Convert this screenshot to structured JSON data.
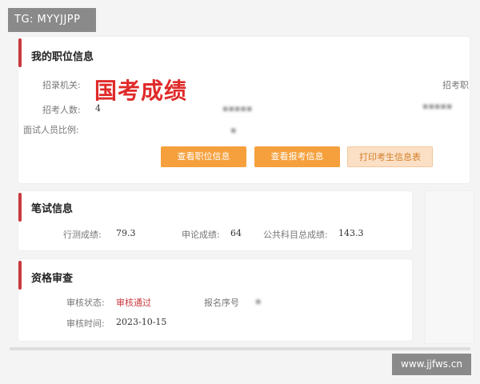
{
  "watermark_top": "TG: MYYJJPP",
  "watermark_bottom": "www.jjfws.cn",
  "stamp_text": "国考成绩",
  "position_info": {
    "title": "我的职位信息",
    "recruit_org_label": "招录机关:",
    "recruit_count_label": "招考人数:",
    "recruit_count_value": "4",
    "interview_ratio_label": "面试人员比例:",
    "right_label_1": "招考职"
  },
  "buttons": {
    "view_position": "查看职位信息",
    "view_application": "查看报考信息",
    "print_info": "打印考生信息表"
  },
  "written_exam": {
    "title": "笔试信息",
    "items": [
      {
        "label": "行测成绩:",
        "value": "79.3"
      },
      {
        "label": "申论成绩:",
        "value": "64"
      },
      {
        "label": "公共科目总成绩:",
        "value": "143.3"
      }
    ]
  },
  "qualification": {
    "title": "资格审查",
    "status_label": "审核状态:",
    "status_value": "审核通过",
    "serial_label": "报名序号",
    "time_label": "审核时间:",
    "time_value": "2023-10-15"
  },
  "colors": {
    "accent_red": "#c9393f",
    "button_orange": "#f5a03c",
    "button_light": "#fbe0c6"
  }
}
